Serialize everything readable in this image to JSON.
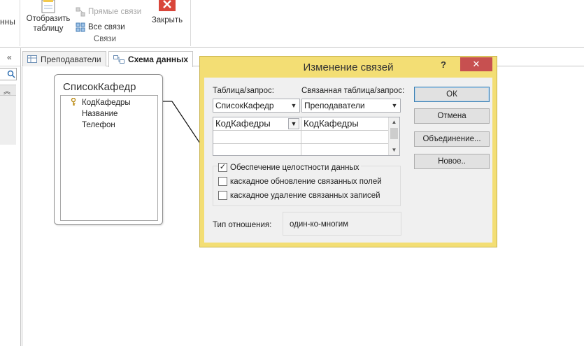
{
  "ribbon": {
    "cut_label": "нны",
    "show_table_line1": "Отобразить",
    "show_table_line2": "таблицу",
    "direct_links": "Прямые связи",
    "all_links": "Все связи",
    "close": "Закрыть",
    "group_label": "Связи"
  },
  "tabs": [
    {
      "label": "Преподаватели"
    },
    {
      "label": "Схема данных"
    }
  ],
  "table_box": {
    "title": "СписокКафедр",
    "fields": [
      "КодКафедры",
      "Название",
      "Телефон"
    ]
  },
  "dialog": {
    "title": "Изменение связей",
    "help": "?",
    "table_label": "Таблица/запрос:",
    "related_label": "Связанная таблица/запрос:",
    "table_value": "СписокКафедр",
    "related_value": "Преподаватели",
    "grid": {
      "left": "КодКафедры",
      "right": "КодКафедры"
    },
    "integrity": "Обеспечение целостности данных",
    "cascade_update": "каскадное обновление связанных полей",
    "cascade_delete": "каскадное удаление связанных записей",
    "reltype_label": "Тип отношения:",
    "reltype_value": "один-ко-многим",
    "buttons": {
      "ok": "ОК",
      "cancel": "Отмена",
      "join": "Объединение...",
      "new": "Новое.."
    }
  },
  "colors": {
    "dialog_border": "#f3de74",
    "close_button": "#c75050"
  }
}
